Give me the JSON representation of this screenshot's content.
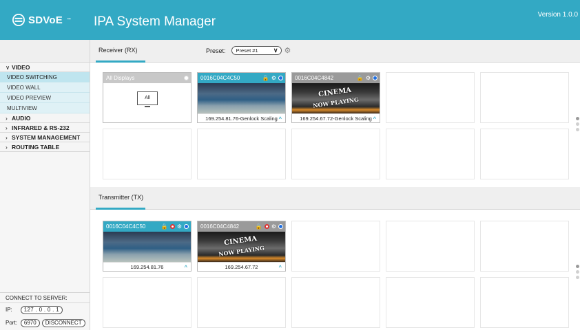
{
  "header": {
    "brand": "SDVoE",
    "brand_tm": "™",
    "title": "IPA System Manager",
    "version": "Version 1.0.0"
  },
  "sidebar": {
    "sections": [
      {
        "label": "VIDEO",
        "expanded": true,
        "items": [
          "VIDEO SWITCHING",
          "VIDEO WALL",
          "VIDEO PREVIEW",
          "MULTIVIEW"
        ],
        "active": "VIDEO SWITCHING"
      },
      {
        "label": "AUDIO",
        "expanded": false
      },
      {
        "label": "INFRARED & RS-232",
        "expanded": false
      },
      {
        "label": "SYSTEM MANAGEMENT",
        "expanded": false
      },
      {
        "label": "ROUTING TABLE",
        "expanded": false
      }
    ],
    "connect": {
      "title": "CONNECT TO SERVER:",
      "ip_label": "IP:",
      "ip_value": "127 . 0 . 0 . 1",
      "port_label": "Port:",
      "port_value": "6970",
      "disconnect_label": "DISCONNECT"
    }
  },
  "receiver": {
    "tab_label": "Receiver (RX)",
    "preset_label": "Preset:",
    "preset_value": "Preset #1",
    "tiles": [
      {
        "title": "All Displays",
        "type": "all",
        "all_label": "All"
      },
      {
        "title": "0016C04C4C50",
        "type": "race",
        "footer": "169.254.81.76-Genlock Scaling"
      },
      {
        "title": "0016C04C4842",
        "type": "cinema",
        "footer": "169.254.67.72-Genlock Scaling"
      }
    ]
  },
  "transmitter": {
    "tab_label": "Transmitter (TX)",
    "tiles": [
      {
        "title": "0016C04C4C50",
        "type": "race",
        "footer": "169.254.81.76"
      },
      {
        "title": "0016C04C4842",
        "type": "cinema",
        "footer": "169.254.67.72"
      }
    ]
  },
  "image_text": {
    "cinema_sign": "CINEMA",
    "now_playing": "NOW PLAYING"
  },
  "colors": {
    "accent": "#33a9c4",
    "status_blue": "#1f6fe0",
    "status_red": "#dd3333"
  }
}
